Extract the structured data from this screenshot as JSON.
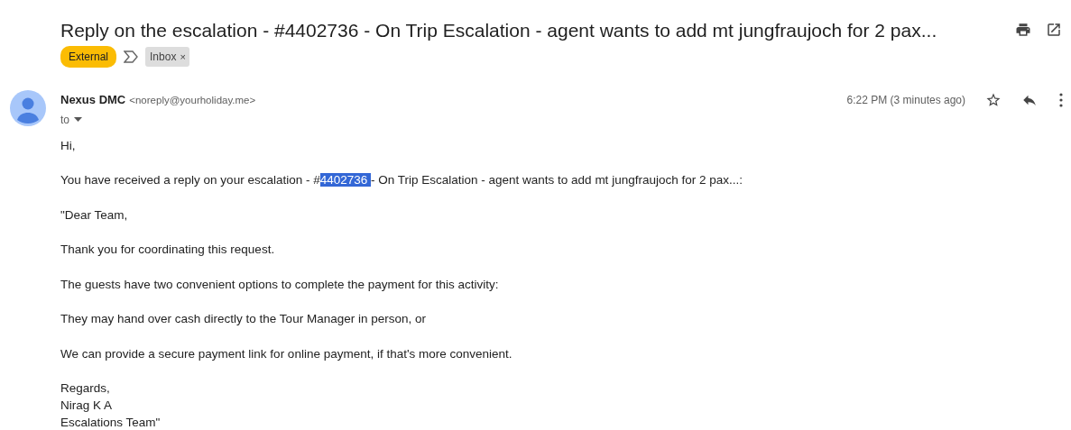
{
  "subject": "Reply on the escalation - #4402736 - On Trip Escalation - agent wants to add mt jungfraujoch for 2 pax...",
  "labels": [
    {
      "kind": "external",
      "text": "External"
    },
    {
      "kind": "inbox",
      "text": "Inbox",
      "close": "×"
    }
  ],
  "sender": {
    "name": "Nexus DMC",
    "email": "<noreply@yourholiday.me>",
    "to": "to",
    "time": "6:22 PM (3 minutes ago)",
    "starred": false
  },
  "body": [
    {
      "text": "Hi,"
    },
    {
      "text": "You have received a reply on your escalation - #",
      "selected_text": "4402736 ",
      "after": "- On Trip Escalation - agent wants to add mt jungfraujoch for 2 pax...:"
    },
    {
      "text": "\"Dear Team,"
    },
    {
      "text": "Thank you for coordinating this request."
    },
    {
      "text": "The guests have two convenient options to complete the payment for this activity:"
    },
    {
      "text": "They may hand over cash directly to the Tour Manager in person, or"
    },
    {
      "text": "We can provide a secure payment link for online payment, if that's more convenient."
    },
    {
      "lines": [
        "Regards,",
        "Nirag K A",
        "Escalations Team\""
      ]
    }
  ]
}
